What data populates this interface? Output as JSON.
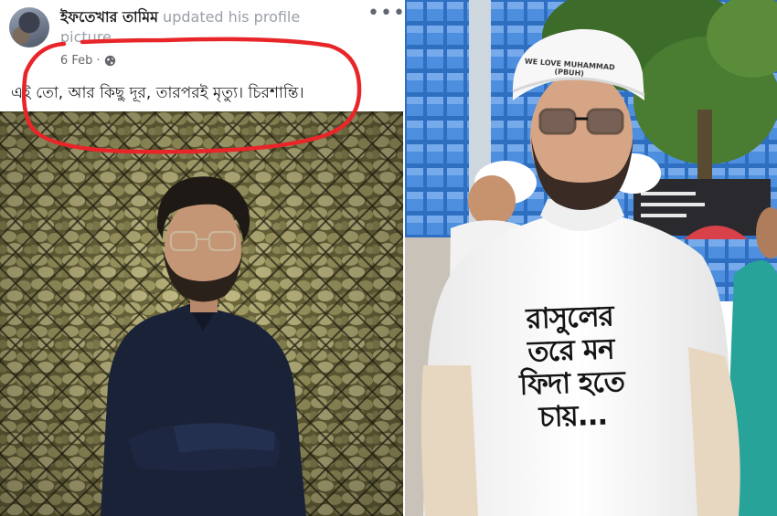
{
  "post": {
    "author_name": "ইফতেখার তামিম",
    "action_text": " updated his profile picture.",
    "date": "6 Feb",
    "date_separator": "·",
    "audience_icon": "globe-icon",
    "more_icon": "more-horizontal-icon",
    "more_label": "•••",
    "body_text": "এই তো, আর কিছু দূর, তারপরই মৃত্যু। চিরশান্তি।",
    "highlight_color": "#e8262a"
  },
  "street_photo": {
    "cap_text": "WE LOVE MUHAMMAD (PBUH)",
    "shirt_text": "রাসুলের তরে মন ফিদা হতে চায়..."
  },
  "colors": {
    "text_primary": "#1c1e21",
    "text_secondary": "#65676b",
    "highlight": "#e8262a"
  }
}
